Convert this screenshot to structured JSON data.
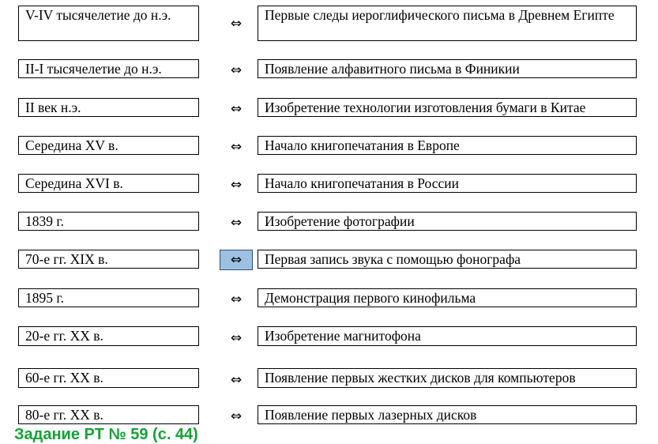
{
  "arrow_glyph": "⇔",
  "rows": [
    {
      "date": "V-IV тысячелетие до н.э.",
      "event": "Первые следы иероглифического письма в Древнем Египте"
    },
    {
      "date": "II-I тысячелетие до н.э.",
      "event": "Появление алфавитного письма в Финикии"
    },
    {
      "date": "II век н.э.",
      "event": "Изобретение технологии изготовления бумаги в Китае"
    },
    {
      "date": "Середина XV в.",
      "event": "Начало книгопечатания в Европе"
    },
    {
      "date": "Середина XVI в.",
      "event": "Начало книгопечатания в России"
    },
    {
      "date": "1839 г.",
      "event": "Изобретение фотографии"
    },
    {
      "date": "70-е гг. XIX в.",
      "event": "Первая запись звука с помощью фонографа"
    },
    {
      "date": "1895 г.",
      "event": "Демонстрация первого кинофильма"
    },
    {
      "date": "20-е гг. XX в.",
      "event": "Изобретение магнитофона"
    },
    {
      "date": "60-е гг. XX в.",
      "event": "Появление первых жестких дисков для компьютеров"
    },
    {
      "date": "80-е гг. XX в.",
      "event": "Появление первых лазерных дисков"
    }
  ],
  "footer_text": "Задание РТ  № 59 (с. 44)",
  "colors": {
    "arrow_selected_bg": "#9dc0e2",
    "footer": "#13a336"
  }
}
